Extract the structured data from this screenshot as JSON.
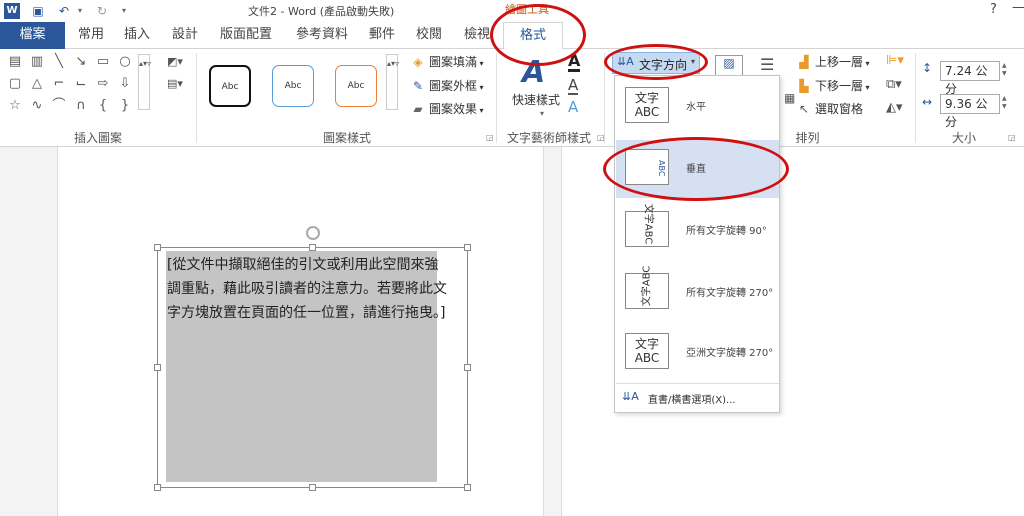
{
  "title_bar": {
    "doc_title": "文件2 - Word (產品啟動失敗)",
    "contextual": "繪圖工具",
    "help": "?",
    "minimize": "—",
    "word_logo": "W"
  },
  "tabs": [
    "檔案",
    "常用",
    "插入",
    "設計",
    "版面配置",
    "參考資料",
    "郵件",
    "校閱",
    "檢視",
    "格式"
  ],
  "ribbon": {
    "groups": {
      "insert_shapes": "插入圖案",
      "shape_styles": "圖案樣式",
      "wordart": "文字藝術師樣式",
      "arrange": "排列",
      "size": "大小"
    },
    "style_sample": "Abc",
    "fill": "圖案填滿",
    "outline": "圖案外框",
    "effects": "圖案效果",
    "quick_styles": "快速樣式",
    "text_direction": "文字方向",
    "bring_forward": "上移一層",
    "send_backward": "下移一層",
    "selection_pane": "選取窗格",
    "height": "7.24 公分",
    "width": "9.36 公分"
  },
  "textbox": {
    "text": "[從文件中擷取絕佳的引文或利用此空間來強調重點，藉此吸引讀者的注意力。若要將此文字方塊放置在頁面的任一位置，請進行拖曳。]"
  },
  "dropdown": {
    "items": [
      {
        "icon": "文字ABC",
        "label": "水平"
      },
      {
        "icon": "ABC",
        "label": "垂直"
      },
      {
        "icon": "文字ABC",
        "label": "所有文字旋轉 90°"
      },
      {
        "icon": "文字ABC",
        "label": "所有文字旋轉 270°"
      },
      {
        "icon": "文字ABC",
        "label": "亞洲文字旋轉 270°"
      }
    ],
    "footer": "直書/橫書選項(X)..."
  },
  "colors": {
    "accent": "#2b579a",
    "highlight": "#d5e1f2",
    "annotation": "#d01010"
  }
}
